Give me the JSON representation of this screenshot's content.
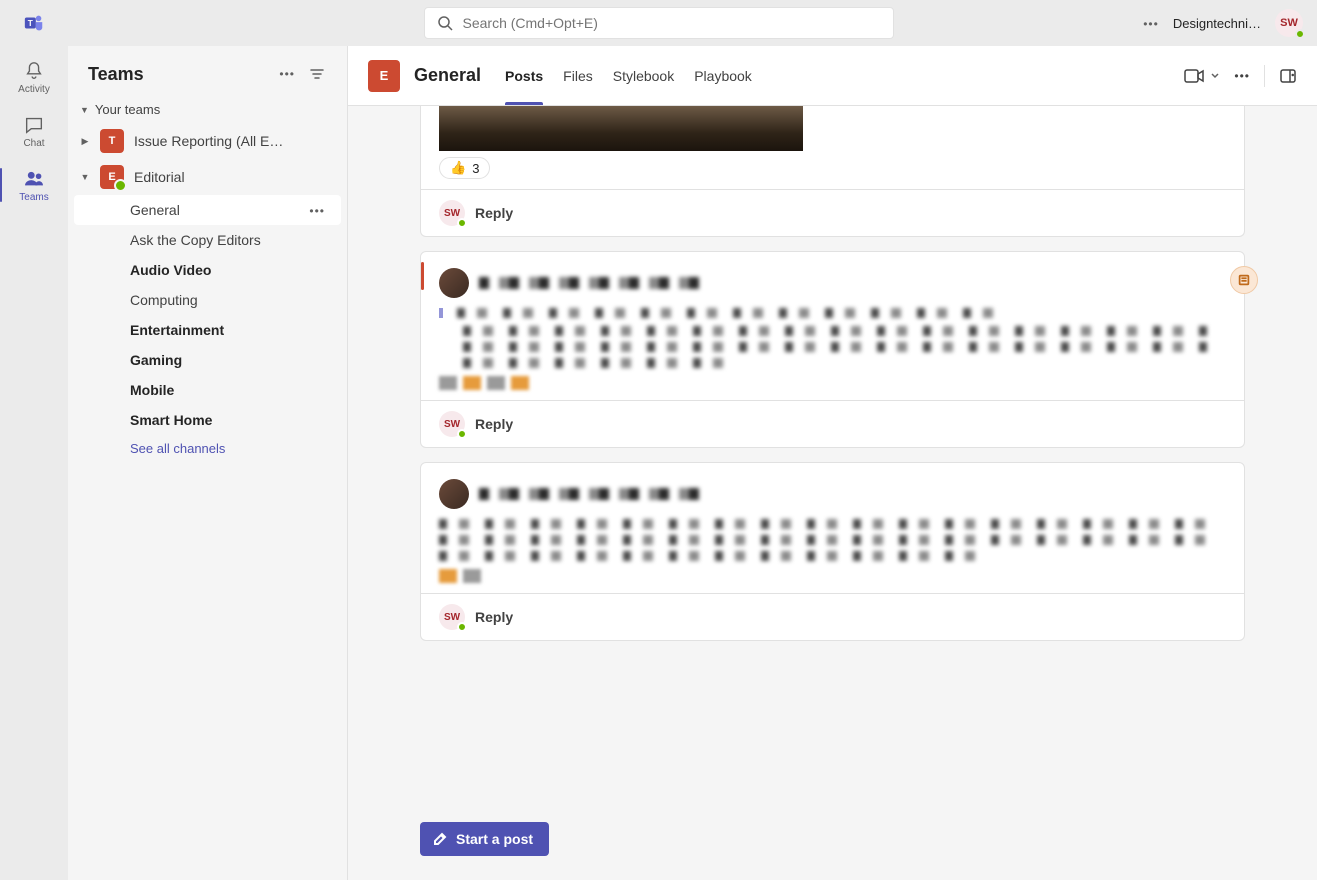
{
  "topbar": {
    "search_placeholder": "Search (Cmd+Opt+E)",
    "org_label": "Designtechni…",
    "user_initials": "SW"
  },
  "rail": {
    "items": [
      {
        "id": "activity",
        "label": "Activity"
      },
      {
        "id": "chat",
        "label": "Chat"
      },
      {
        "id": "teams",
        "label": "Teams"
      }
    ],
    "active": "teams"
  },
  "sidebar": {
    "title": "Teams",
    "section_label": "Your teams",
    "teams": [
      {
        "id": "issue",
        "initial": "T",
        "name": "Issue Reporting (All E…",
        "expanded": false
      },
      {
        "id": "editorial",
        "initial": "E",
        "name": "Editorial",
        "expanded": true
      }
    ],
    "channels": [
      {
        "name": "General",
        "state": "active"
      },
      {
        "name": "Ask the Copy Editors",
        "state": "read"
      },
      {
        "name": "Audio Video",
        "state": "unread"
      },
      {
        "name": "Computing",
        "state": "read"
      },
      {
        "name": "Entertainment",
        "state": "unread"
      },
      {
        "name": "Gaming",
        "state": "unread"
      },
      {
        "name": "Mobile",
        "state": "unread"
      },
      {
        "name": "Smart Home",
        "state": "unread"
      }
    ],
    "see_all": "See all channels"
  },
  "channel_header": {
    "team_initial": "E",
    "title": "General",
    "tabs": [
      "Posts",
      "Files",
      "Stylebook",
      "Playbook"
    ],
    "active_tab": "Posts"
  },
  "posts": {
    "reaction_emoji": "👍",
    "reaction_count": "3",
    "reply_label": "Reply",
    "reply_initials": "SW"
  },
  "compose": {
    "start_post": "Start a post"
  }
}
